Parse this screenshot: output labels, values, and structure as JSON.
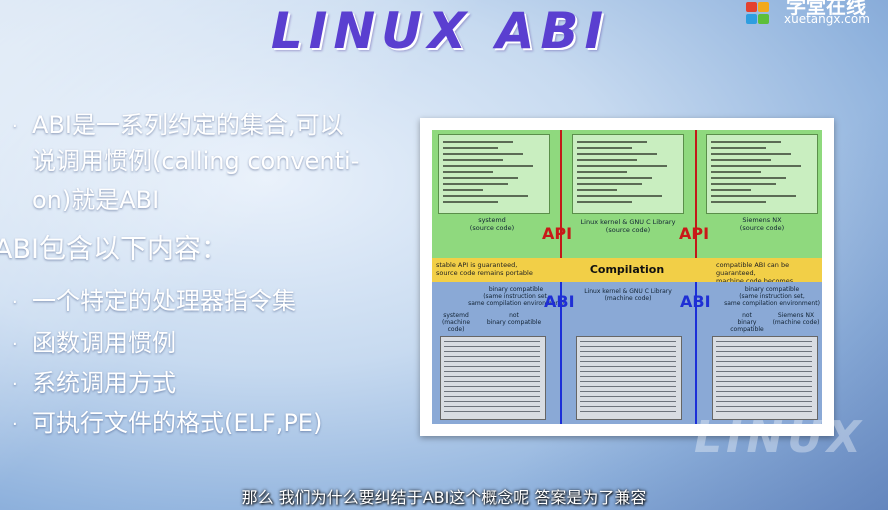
{
  "slide": {
    "title": "LINUX ABI",
    "watermark": "LINUX"
  },
  "logo": {
    "chinese": "学堂在线",
    "url": "xuetangx.com"
  },
  "bullets": [
    {
      "text": "ABI是一系列约定的集合,可以",
      "dot": "·"
    },
    {
      "text": "说调用惯例(calling conventi-",
      "dot": ""
    },
    {
      "text": "on)就是ABI",
      "dot": ""
    },
    {
      "text": "ABI包含以下内容：",
      "dot": ""
    },
    {
      "text": "一个特定的处理器指令集",
      "dot": "·"
    },
    {
      "text": "函数调用惯例",
      "dot": "·"
    },
    {
      "text": "系统调用方式",
      "dot": "·"
    },
    {
      "text": "可执行文件的格式(ELF,PE)",
      "dot": "·"
    }
  ],
  "figure": {
    "top_labels": [
      {
        "name": "systemd",
        "sub": "(source code)"
      },
      {
        "name": "Linux kernel & GNU C Library",
        "sub": "(source code)"
      },
      {
        "name": "Siemens NX",
        "sub": "(source code)"
      }
    ],
    "api_label": "API",
    "abi_label": "ABI",
    "band": {
      "left_line1": "stable API is guaranteed,",
      "left_line2": "source code remains portable",
      "center": "Compilation",
      "right_line1": "compatible ABI can be guaranteed,",
      "right_line2": "machine code becomes portable"
    },
    "bottom_left": {
      "compat": "binary compatible",
      "compat_sub1": "(same instruction set,",
      "compat_sub2": "same compilation environment)",
      "name": "systemd",
      "name_sub": "(machine code)",
      "not": "not",
      "not_sub": "binary compatible"
    },
    "bottom_center": {
      "name": "Linux kernel & GNU C Library",
      "name_sub": "(machine code)"
    },
    "bottom_right": {
      "compat": "binary compatible",
      "compat_sub1": "(same instruction set,",
      "compat_sub2": "same compilation environment)",
      "name": "Siemens NX",
      "name_sub": "(machine code)",
      "not": "not",
      "not_sub": "binary compatible"
    }
  },
  "caption": "那么 我们为什么要纠结于ABI这个概念呢 答案是为了兼容",
  "colors": {
    "title": "#5a3fd0",
    "api": "#c91818",
    "abi": "#1f2fd5",
    "green_region": "#8fd97e",
    "blue_region": "#8aa9d6",
    "band": "#f2cf47"
  }
}
